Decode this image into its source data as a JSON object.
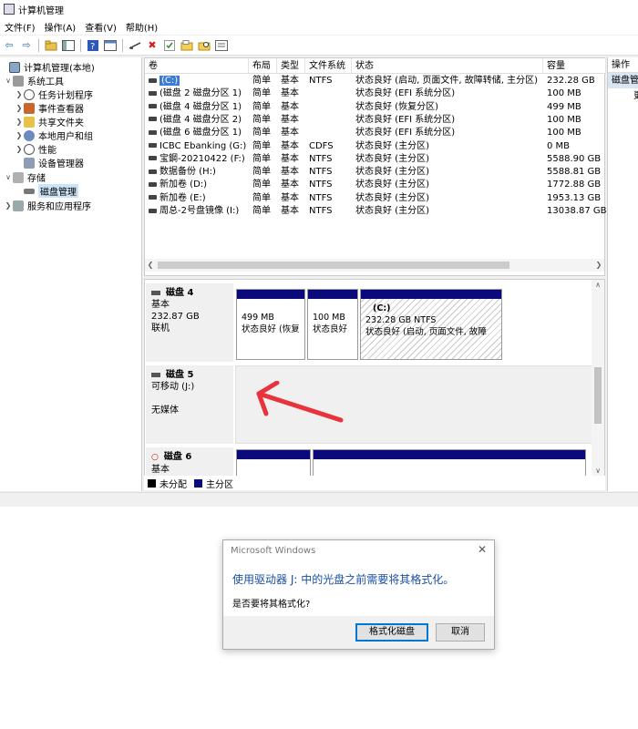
{
  "window": {
    "title": "计算机管理",
    "menu": [
      "文件(F)",
      "操作(A)",
      "查看(V)",
      "帮助(H)"
    ]
  },
  "tree": {
    "items": [
      {
        "label": "计算机管理(本地)",
        "icon": "computer-icon"
      },
      {
        "label": "系统工具",
        "icon": "tools-icon"
      },
      {
        "label": "任务计划程序",
        "icon": "clock-icon"
      },
      {
        "label": "事件查看器",
        "icon": "event-viewer-icon"
      },
      {
        "label": "共享文件夹",
        "icon": "shared-folder-icon"
      },
      {
        "label": "本地用户和组",
        "icon": "users-icon"
      },
      {
        "label": "性能",
        "icon": "performance-icon"
      },
      {
        "label": "设备管理器",
        "icon": "device-manager-icon"
      },
      {
        "label": "存储",
        "icon": "storage-icon"
      },
      {
        "label": "磁盘管理",
        "icon": "disk-management-icon"
      },
      {
        "label": "服务和应用程序",
        "icon": "services-icon"
      }
    ]
  },
  "volumes": {
    "columns": [
      "卷",
      "布局",
      "类型",
      "文件系统",
      "状态",
      "容量"
    ],
    "rows": [
      [
        "(C:)",
        "简单",
        "基本",
        "NTFS",
        "状态良好 (启动, 页面文件, 故障转储, 主分区)",
        "232.28 GB"
      ],
      [
        "(磁盘 2 磁盘分区 1)",
        "简单",
        "基本",
        "",
        "状态良好 (EFI 系统分区)",
        "100 MB"
      ],
      [
        "(磁盘 4 磁盘分区 1)",
        "简单",
        "基本",
        "",
        "状态良好 (恢复分区)",
        "499 MB"
      ],
      [
        "(磁盘 4 磁盘分区 2)",
        "简单",
        "基本",
        "",
        "状态良好 (EFI 系统分区)",
        "100 MB"
      ],
      [
        "(磁盘 6 磁盘分区 1)",
        "简单",
        "基本",
        "",
        "状态良好 (EFI 系统分区)",
        "100 MB"
      ],
      [
        "ICBC Ebanking (G:)",
        "简单",
        "基本",
        "CDFS",
        "状态良好 (主分区)",
        "0 MB"
      ],
      [
        "宝鋼-20210422 (F:)",
        "简单",
        "基本",
        "NTFS",
        "状态良好 (主分区)",
        "5588.90 GB"
      ],
      [
        "数据备份 (H:)",
        "简单",
        "基本",
        "NTFS",
        "状态良好 (主分区)",
        "5588.81 GB"
      ],
      [
        "新加卷 (D:)",
        "简单",
        "基本",
        "NTFS",
        "状态良好 (主分区)",
        "1772.88 GB"
      ],
      [
        "新加卷 (E:)",
        "简单",
        "基本",
        "NTFS",
        "状态良好 (主分区)",
        "1953.13 GB"
      ],
      [
        "周总-2号盘镜像 (I:)",
        "简单",
        "基本",
        "NTFS",
        "状态良好 (主分区)",
        "13038.87 GB"
      ]
    ]
  },
  "disks": {
    "disk4": {
      "name": "磁盘 4",
      "type": "基本",
      "size": "232.87 GB",
      "status": "联机",
      "partitions": [
        {
          "size": "499 MB",
          "status": "状态良好 (恢复"
        },
        {
          "size": "100 MB",
          "status": "状态良好"
        },
        {
          "label": "(C:)",
          "size": "232.28 GB NTFS",
          "status": "状态良好 (启动, 页面文件, 故障"
        }
      ]
    },
    "disk5": {
      "name": "磁盘 5",
      "type": "可移动 (J:)",
      "status": "无媒体"
    },
    "disk6": {
      "name": "磁盘 6",
      "type": "基本"
    }
  },
  "legend": {
    "unallocated": "未分配",
    "primary": "主分区",
    "colors": {
      "unallocated": "#000000",
      "primary": "#0a0a7c"
    }
  },
  "actions": {
    "header": "操作",
    "item": "磁盘管理",
    "more": "更"
  },
  "dialog": {
    "title": "Microsoft Windows",
    "message": "使用驱动器 J: 中的光盘之前需要将其格式化。",
    "question": "是否要将其格式化?",
    "format_button": "格式化磁盘",
    "cancel_button": "取消"
  },
  "annotation": {
    "color": "#e8323c"
  }
}
